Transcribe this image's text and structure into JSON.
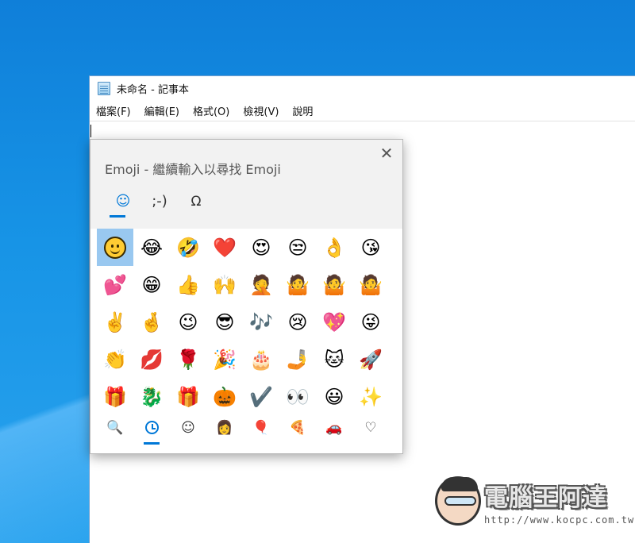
{
  "notepad": {
    "title": "未命名 - 記事本",
    "menu": [
      "檔案(F)",
      "編輯(E)",
      "格式(O)",
      "檢視(V)",
      "說明"
    ]
  },
  "emoji_panel": {
    "title": "Emoji - 繼續輸入以尋找 Emoji",
    "close_label": "✕",
    "category_tabs": [
      {
        "label": "☺",
        "name": "emoji"
      },
      {
        "label": ";-)",
        "name": "kaomoji"
      },
      {
        "label": "Ω",
        "name": "symbols"
      }
    ],
    "emojis": [
      "😊",
      "😂",
      "🤣",
      "❤️",
      "😍",
      "😒",
      "👌",
      "😘",
      "💕",
      "😁",
      "👍",
      "🙌",
      "🤦",
      "🤷",
      "🤷",
      "🤷",
      "✌️",
      "🤞",
      "😉",
      "😎",
      "🎶",
      "😢",
      "💖",
      "😜",
      "👏",
      "💋",
      "🌹",
      "🎉",
      "🎂",
      "🤳",
      "🐱",
      "🚀",
      "🎁",
      "🐉",
      "🎁",
      "🎃",
      "✔️",
      "👀",
      "😃",
      "✨"
    ],
    "bottom_tabs": [
      {
        "label": "🔍",
        "name": "search"
      },
      {
        "label": "",
        "name": "recent"
      },
      {
        "label": "☺",
        "name": "smileys"
      },
      {
        "label": "👩",
        "name": "people"
      },
      {
        "label": "🎈",
        "name": "celebration"
      },
      {
        "label": "🍕",
        "name": "food"
      },
      {
        "label": "🚗",
        "name": "travel"
      },
      {
        "label": "♡",
        "name": "heart"
      }
    ]
  },
  "watermark": {
    "title": "電腦王阿達",
    "url": "http://www.kocpc.com.tw"
  }
}
